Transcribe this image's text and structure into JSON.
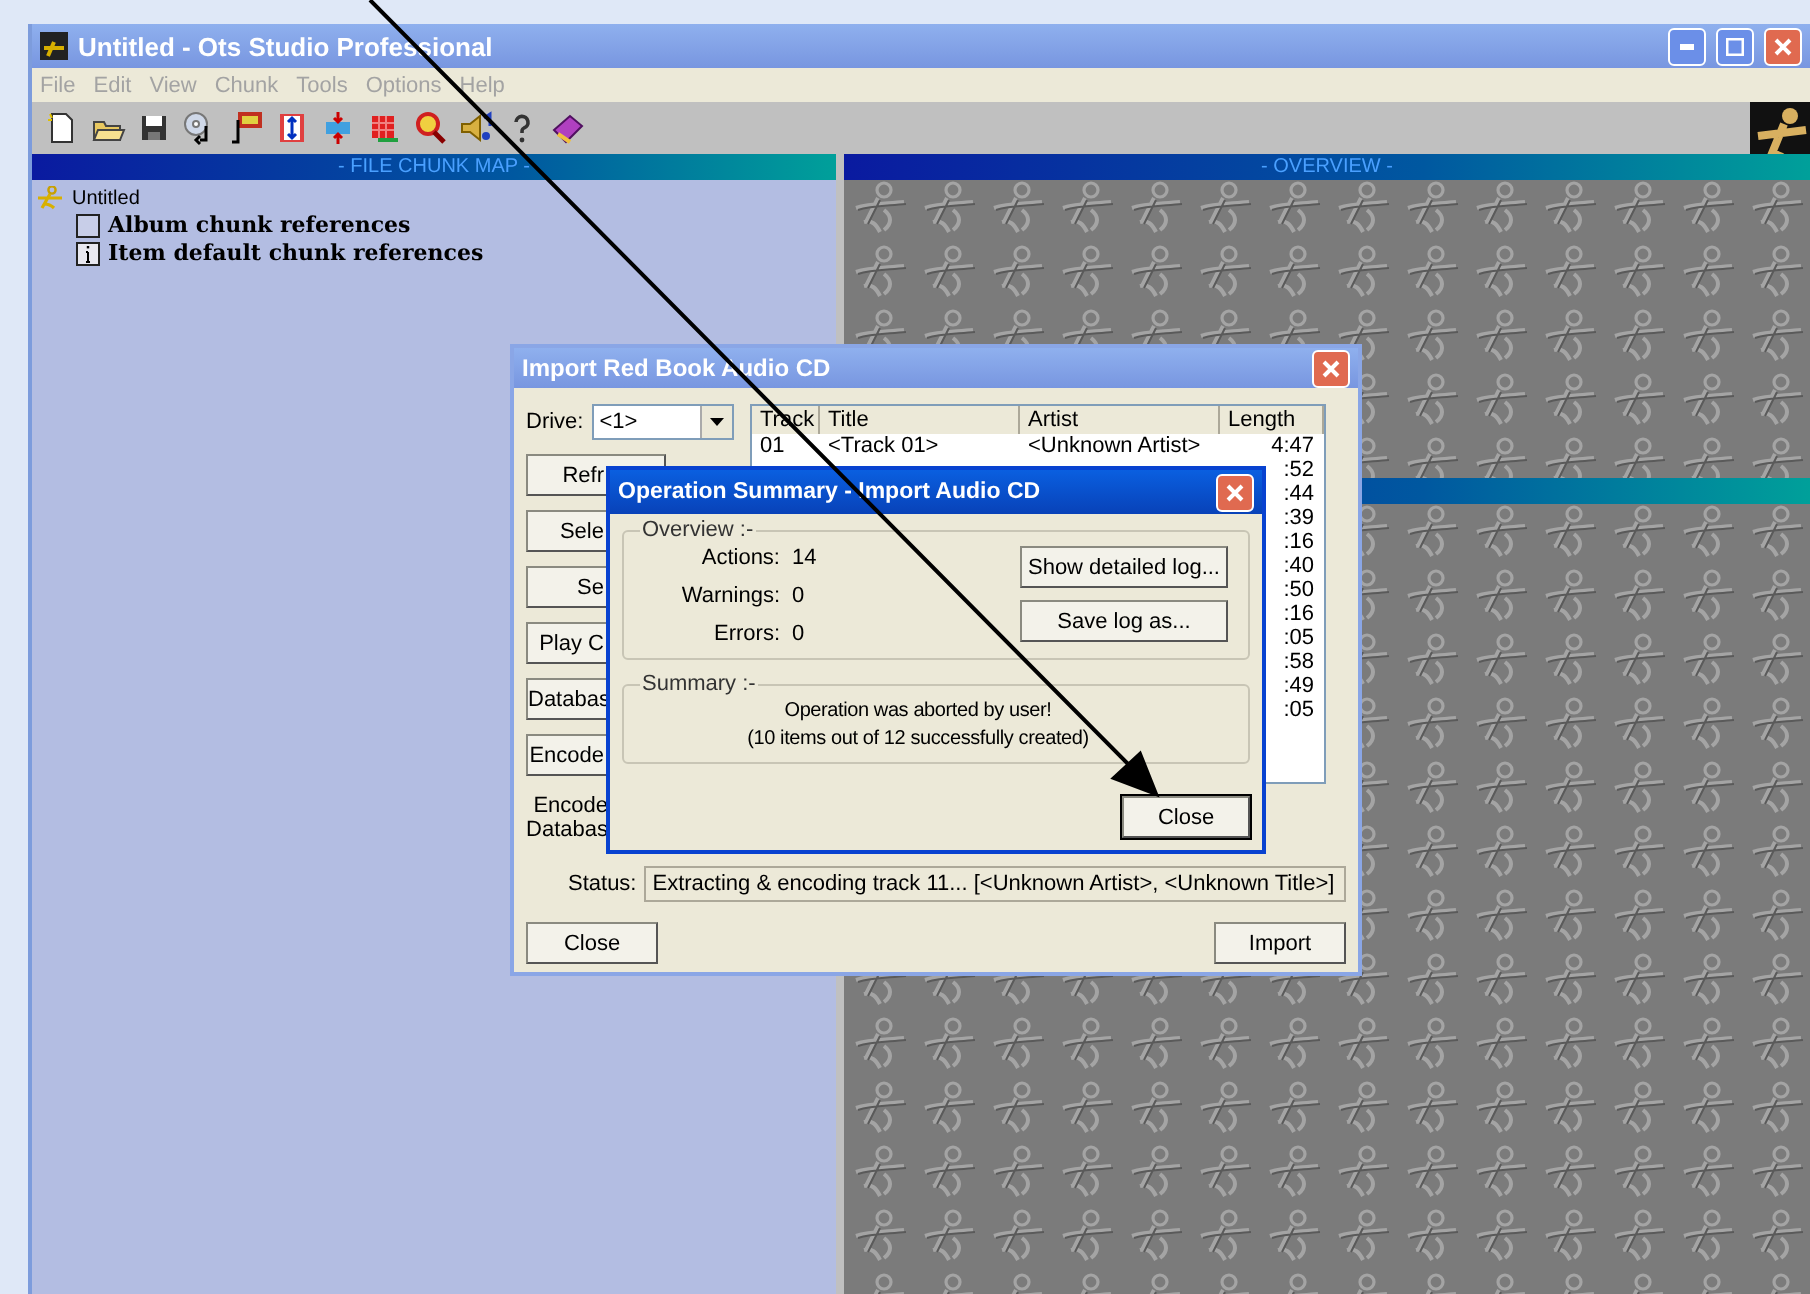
{
  "main_window": {
    "title": "Untitled - Ots Studio Professional",
    "active": false,
    "menu": [
      "File",
      "Edit",
      "View",
      "Chunk",
      "Tools",
      "Options",
      "Help"
    ]
  },
  "file_chunk_map": {
    "header": "- FILE CHUNK MAP -",
    "tree": [
      {
        "label": "Untitled",
        "kind": "root",
        "children": [
          {
            "label": "Album chunk references",
            "kind": "album"
          },
          {
            "label": "Item default chunk references",
            "kind": "item"
          }
        ]
      }
    ]
  },
  "overview": {
    "header": "- OVERVIEW -"
  },
  "import_dialog": {
    "title": "Import Red Book Audio CD",
    "active": false,
    "drive_label": "Drive:",
    "drive_value": "<1>",
    "buttons": [
      "Refr",
      "Sele",
      "Se",
      "Play C",
      "Databas",
      "Encode"
    ],
    "encoder_labels": [
      "Encode",
      "Databas"
    ],
    "list": {
      "columns": [
        "Track",
        "Title",
        "Artist",
        "Length"
      ],
      "rows": [
        {
          "track": "01",
          "title": "<Track 01>",
          "artist": "<Unknown Artist>",
          "length": "4:47"
        },
        {
          "length": ":52"
        },
        {
          "length": ":44"
        },
        {
          "length": ":39"
        },
        {
          "length": ":16"
        },
        {
          "length": ":40"
        },
        {
          "length": ":50"
        },
        {
          "length": ":16"
        },
        {
          "length": ":05"
        },
        {
          "length": ":58"
        },
        {
          "length": ":49"
        },
        {
          "length": ":05"
        }
      ]
    },
    "status_label": "Status:",
    "status": "Extracting & encoding track 11... [<Unknown Artist>, <Unknown Title>]",
    "close": "Close",
    "import": "Import"
  },
  "summary_dialog": {
    "title": "Operation Summary - Import Audio CD",
    "active": true,
    "overview": {
      "legend": "Overview :-",
      "stats": [
        {
          "label": "Actions:",
          "value": "14"
        },
        {
          "label": "Warnings:",
          "value": "0"
        },
        {
          "label": "Errors:",
          "value": "0"
        }
      ]
    },
    "buttons": [
      "Show detailed log...",
      "Save log as..."
    ],
    "summary": {
      "legend": "Summary :-",
      "lines": [
        "Operation was aborted by user!",
        "(10 items out of 12 successfully created)"
      ]
    },
    "close": "Close"
  }
}
